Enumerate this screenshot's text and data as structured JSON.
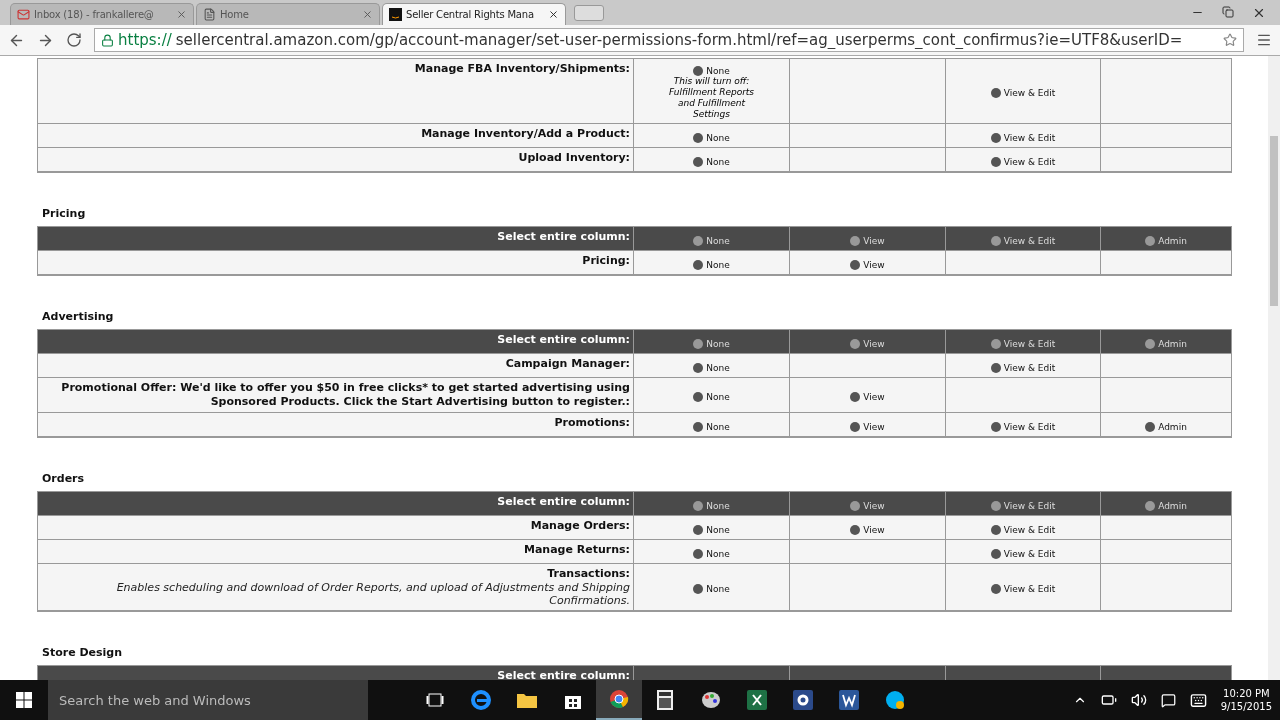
{
  "browser": {
    "tabs": [
      {
        "kind": "mail",
        "label": "Inbox (18) - frankallere@",
        "selected": false
      },
      {
        "kind": "page",
        "label": "Home",
        "selected": false
      },
      {
        "kind": "amazon",
        "label": "Seller Central Rights Mana",
        "selected": true
      }
    ],
    "address": {
      "scheme": "https://",
      "rest": "sellercentral.amazon.com/gp/account-manager/set-user-permissions-form.html/ref=ag_userperms_cont_confirmus?ie=UTF8&userID="
    }
  },
  "sections": [
    {
      "rows": [
        {
          "label": "Manage FBA Inventory/Shipments:",
          "cells": [
            {
              "kind": "radio",
              "option": "None",
              "note": "This will turn off: Fulfillment Reports and Fulfillment Settings"
            },
            {
              "kind": "empty"
            },
            {
              "kind": "radio",
              "option": "View & Edit"
            },
            {
              "kind": "empty"
            }
          ]
        },
        {
          "label": "Manage Inventory/Add a Product:",
          "cells": [
            {
              "kind": "radio",
              "option": "None"
            },
            {
              "kind": "empty"
            },
            {
              "kind": "radio",
              "option": "View & Edit"
            },
            {
              "kind": "empty"
            }
          ]
        },
        {
          "label": "Upload Inventory:",
          "cells": [
            {
              "kind": "radio",
              "option": "None"
            },
            {
              "kind": "empty"
            },
            {
              "kind": "radio",
              "option": "View & Edit"
            },
            {
              "kind": "empty"
            }
          ]
        }
      ]
    },
    {
      "title": "Pricing",
      "header": {
        "label": "Select entire column:",
        "options": [
          "None",
          "View",
          "View & Edit",
          "Admin"
        ]
      },
      "rows": [
        {
          "label": "Pricing:",
          "cells": [
            {
              "kind": "radio",
              "option": "None"
            },
            {
              "kind": "radio",
              "option": "View"
            },
            {
              "kind": "empty"
            },
            {
              "kind": "empty"
            }
          ]
        }
      ]
    },
    {
      "title": "Advertising",
      "header": {
        "label": "Select entire column:",
        "options": [
          "None",
          "View",
          "View & Edit",
          "Admin"
        ]
      },
      "rows": [
        {
          "label": "Campaign Manager:",
          "cells": [
            {
              "kind": "radio",
              "option": "None"
            },
            {
              "kind": "empty"
            },
            {
              "kind": "radio",
              "option": "View & Edit"
            },
            {
              "kind": "empty"
            }
          ]
        },
        {
          "label": "Promotional Offer: We'd like to offer you $50 in free clicks* to get started advertising using Sponsored Products. Click the Start Advertising button to register.:",
          "cells": [
            {
              "kind": "radio",
              "option": "None"
            },
            {
              "kind": "radio",
              "option": "View"
            },
            {
              "kind": "empty"
            },
            {
              "kind": "empty"
            }
          ]
        },
        {
          "label": "Promotions:",
          "cells": [
            {
              "kind": "radio",
              "option": "None"
            },
            {
              "kind": "radio",
              "option": "View"
            },
            {
              "kind": "radio",
              "option": "View & Edit"
            },
            {
              "kind": "radio",
              "option": "Admin"
            }
          ]
        }
      ]
    },
    {
      "title": "Orders",
      "header": {
        "label": "Select entire column:",
        "options": [
          "None",
          "View",
          "View & Edit",
          "Admin"
        ]
      },
      "rows": [
        {
          "label": "Manage Orders:",
          "cells": [
            {
              "kind": "radio",
              "option": "None"
            },
            {
              "kind": "radio",
              "option": "View"
            },
            {
              "kind": "radio",
              "option": "View & Edit"
            },
            {
              "kind": "empty"
            }
          ]
        },
        {
          "label": "Manage Returns:",
          "cells": [
            {
              "kind": "radio",
              "option": "None"
            },
            {
              "kind": "empty"
            },
            {
              "kind": "radio",
              "option": "View & Edit"
            },
            {
              "kind": "empty"
            }
          ]
        },
        {
          "label": "Transactions:",
          "note": "Enables scheduling and download of Order Reports, and upload of Adjustments and Shipping Confirmations.",
          "cells": [
            {
              "kind": "radio",
              "option": "None"
            },
            {
              "kind": "empty"
            },
            {
              "kind": "radio",
              "option": "View & Edit"
            },
            {
              "kind": "empty"
            }
          ]
        }
      ]
    },
    {
      "title": "Store Design",
      "header": {
        "label": "Select entire column:"
      }
    }
  ],
  "taskbar": {
    "search": {
      "placeholder": "Search the web and Windows"
    },
    "apps": [
      {
        "kind": "taskview",
        "selected": false
      },
      {
        "kind": "edge",
        "selected": false
      },
      {
        "kind": "folder",
        "selected": false
      },
      {
        "kind": "store",
        "selected": false
      },
      {
        "kind": "chrome",
        "selected": true
      },
      {
        "kind": "calculator",
        "selected": false
      },
      {
        "kind": "paint",
        "selected": false
      },
      {
        "kind": "excel",
        "selected": false
      },
      {
        "kind": "gear",
        "selected": false
      },
      {
        "kind": "word",
        "selected": false
      },
      {
        "kind": "skype",
        "selected": false
      }
    ],
    "time": "10:20 PM",
    "date": "9/15/2015"
  }
}
